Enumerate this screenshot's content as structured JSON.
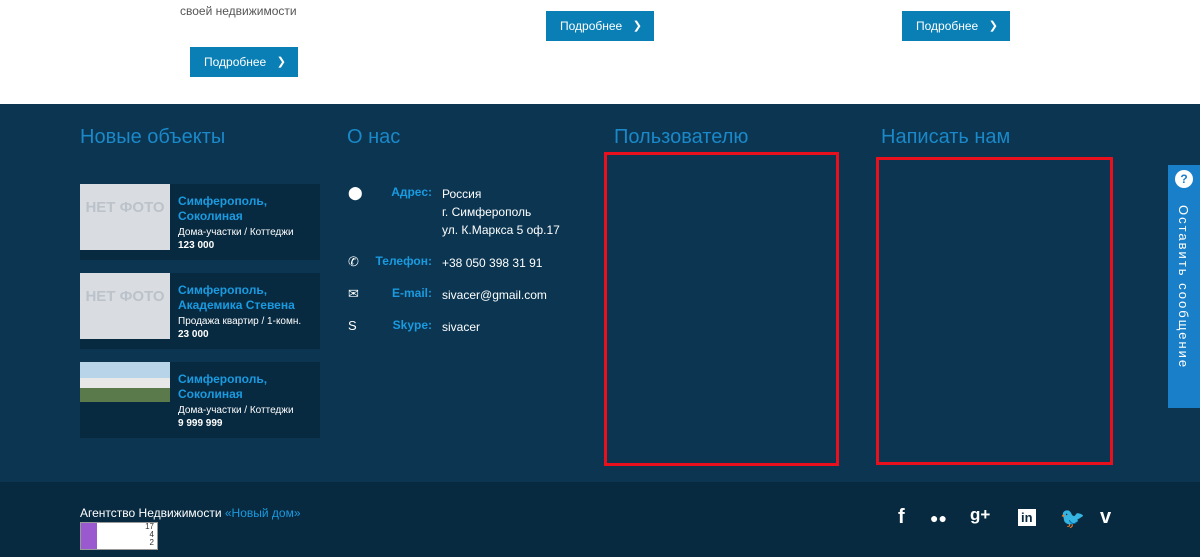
{
  "top": {
    "partial_text": "своей недвижимости",
    "buttons": [
      "Подробнее",
      "Подробнее",
      "Подробнее"
    ]
  },
  "footer": {
    "col_titles": [
      "Новые объекты",
      "О нас",
      "Пользователю",
      "Написать нам"
    ],
    "objects": [
      {
        "thumb": "НЕТ ФОТО",
        "name": "Симферополь, Соколиная",
        "type": "Дома-участки / Коттеджи",
        "price": "123 000"
      },
      {
        "thumb": "НЕТ ФОТО",
        "name": "Симферополь, Академика Стевена",
        "type": "Продажа квартир / 1-комн.",
        "price": "23 000"
      },
      {
        "thumb": "",
        "name": "Симферополь, Соколиная",
        "type": "Дома-участки / Коттеджи",
        "price": "9 999 999"
      }
    ],
    "contacts": {
      "address_label": "Адрес:",
      "address_line1": "Россия",
      "address_line2": "г. Симферополь",
      "address_line3": "ул. К.Маркса 5 оф.17",
      "phone_label": "Телефон:",
      "phone": "+38 050 398 31 91",
      "email_label": "E-mail:",
      "email": "sivacer@gmail.com",
      "skype_label": "Skype:",
      "skype": "sivacer"
    }
  },
  "side_tab": {
    "label": "Оставить сообщение"
  },
  "bottom": {
    "copyright": "Агентство Недвижимости ",
    "copyright_link": "«Новый дом»",
    "counter": {
      "line1": "17",
      "line2": "4",
      "line3": "2"
    },
    "social_icons": [
      "facebook-icon",
      "flickr-icon",
      "google-plus-icon",
      "linkedin-icon",
      "twitter-icon",
      "vimeo-icon"
    ]
  },
  "colors": {
    "accent": "#1a9ae0",
    "footer_bg": "#0b3550",
    "button": "#0a7fb5",
    "highlight": "#e8101c"
  }
}
